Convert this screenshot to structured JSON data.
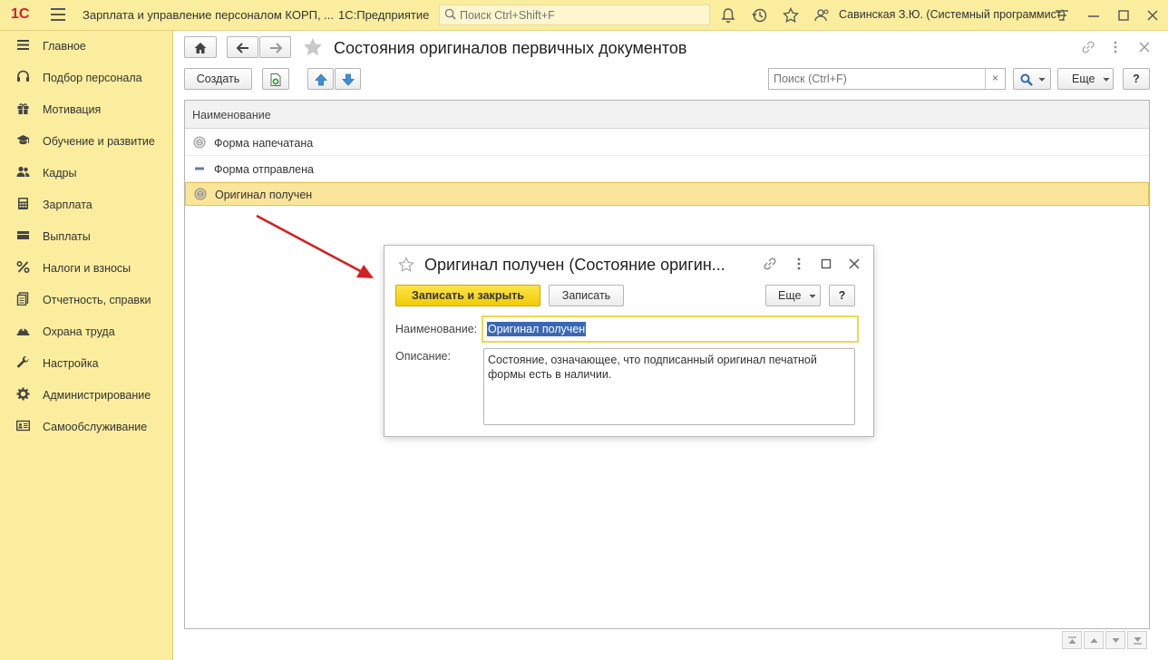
{
  "topbar": {
    "logo": "1С",
    "app_title": "Зарплата и управление персоналом КОРП, ...",
    "platform": "1С:Предприятие",
    "search_placeholder": "Поиск Ctrl+Shift+F",
    "user": "Савинская З.Ю. (Системный программист)"
  },
  "sidebar": {
    "items": [
      {
        "label": "Главное",
        "icon": "menu-lines-icon"
      },
      {
        "label": "Подбор персонала",
        "icon": "headset-icon"
      },
      {
        "label": "Мотивация",
        "icon": "gift-icon"
      },
      {
        "label": "Обучение и развитие",
        "icon": "graduation-cap-icon"
      },
      {
        "label": "Кадры",
        "icon": "people-icon"
      },
      {
        "label": "Зарплата",
        "icon": "calculator-icon"
      },
      {
        "label": "Выплаты",
        "icon": "wallet-icon"
      },
      {
        "label": "Налоги и взносы",
        "icon": "percent-icon"
      },
      {
        "label": "Отчетность, справки",
        "icon": "reports-icon"
      },
      {
        "label": "Охрана труда",
        "icon": "helmet-icon"
      },
      {
        "label": "Настройка",
        "icon": "wrench-icon"
      },
      {
        "label": "Администрирование",
        "icon": "gear-icon"
      },
      {
        "label": "Самообслуживание",
        "icon": "id-card-icon"
      }
    ]
  },
  "main": {
    "title": "Состояния оригиналов первичных документов",
    "create_label": "Создать",
    "search_placeholder": "Поиск (Ctrl+F)",
    "clear_label": "×",
    "more_label": "Еще",
    "help_label": "?",
    "column_header": "Наименование",
    "rows": [
      {
        "name": "Форма напечатана",
        "icon": "printed-status-icon"
      },
      {
        "name": "Форма отправлена",
        "icon": "sent-status-icon"
      },
      {
        "name": "Оригинал получен",
        "icon": "received-status-icon"
      }
    ],
    "selected_row": 2
  },
  "dialog": {
    "title": "Оригинал получен (Состояние оригин...",
    "save_close_label": "Записать и закрыть",
    "save_label": "Записать",
    "more_label": "Еще",
    "help_label": "?",
    "name_label": "Наименование:",
    "name_value": "Оригинал получен",
    "description_label": "Описание:",
    "description_value": "Состояние, означающее, что подписанный оригинал печатной формы есть в наличии."
  },
  "colors": {
    "panel": "#fbed9e",
    "selected_row": "#fbe59a",
    "primary_button": "#f5d20a",
    "arrow": "#d42020"
  }
}
